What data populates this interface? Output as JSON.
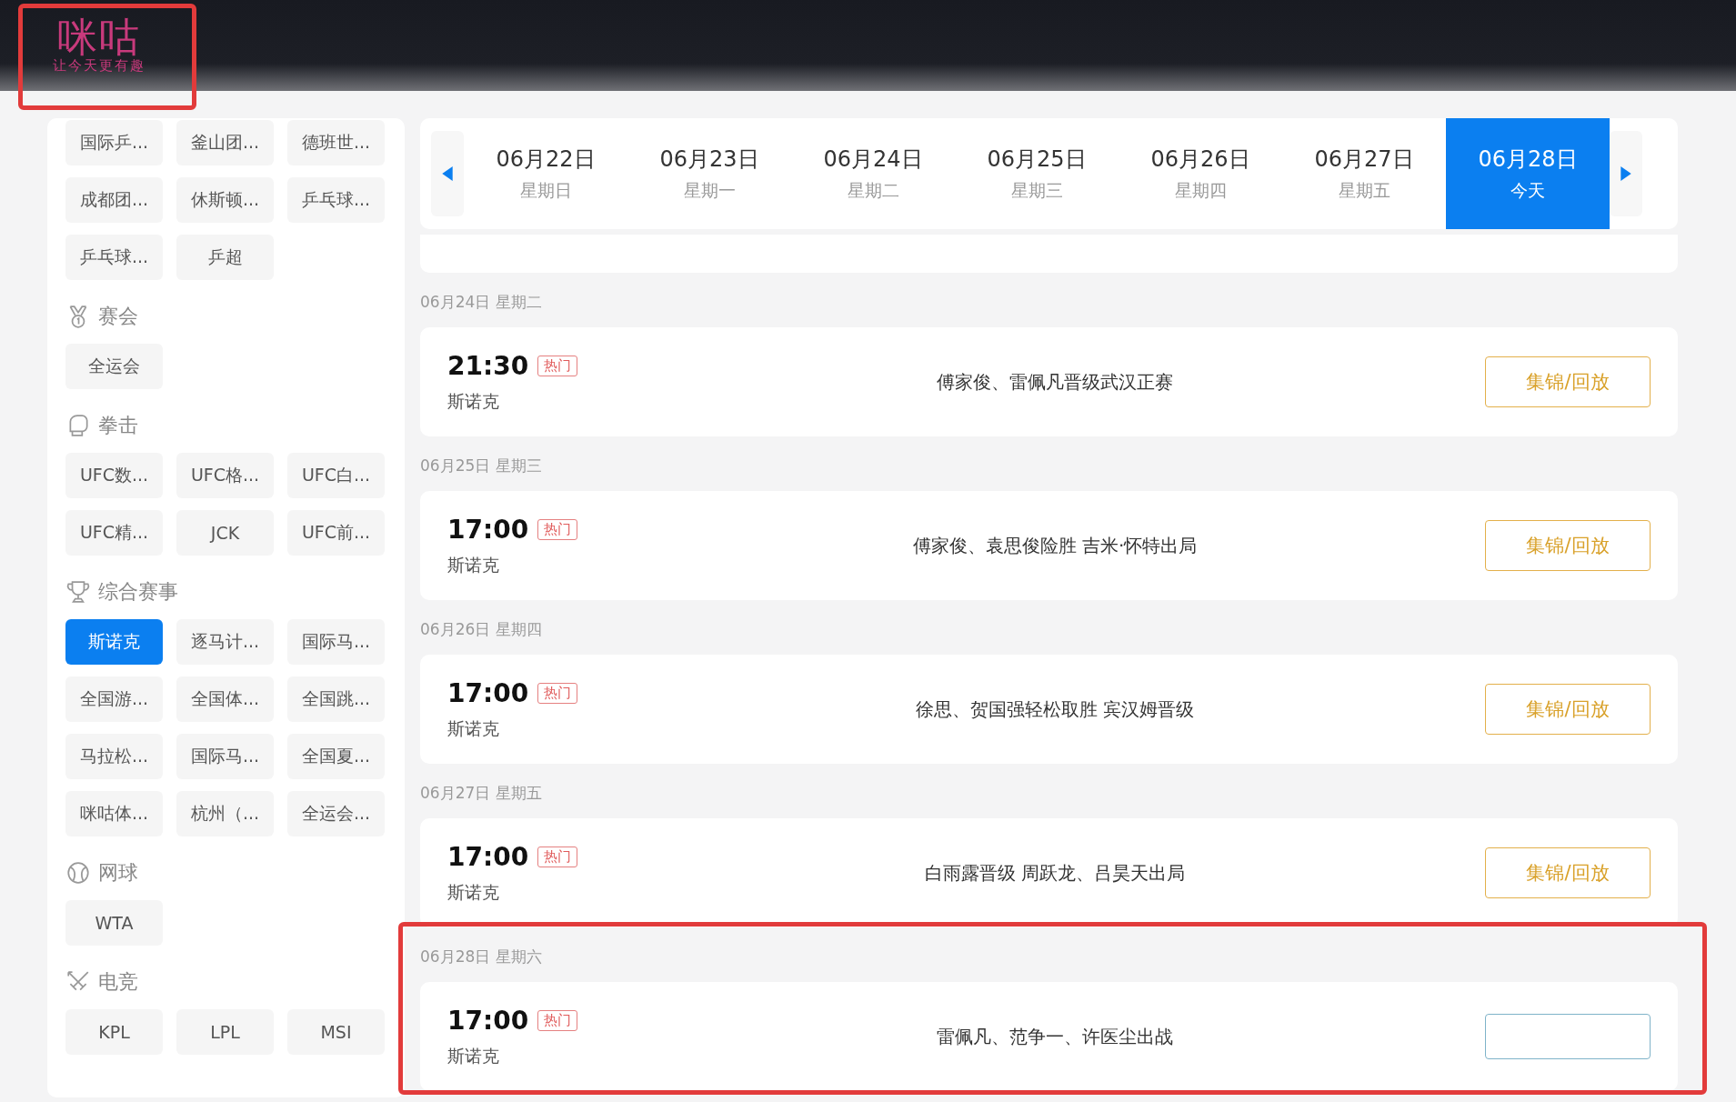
{
  "header": {
    "logo": {
      "name": "咪咕",
      "slogan": "让今天更有趣",
      "highlighted": true
    }
  },
  "sidebar": {
    "groups": [
      {
        "chips": [
          {
            "label": "国际乒...",
            "selected": false
          },
          {
            "label": "釜山团...",
            "selected": false
          },
          {
            "label": "德班世...",
            "selected": false
          },
          {
            "label": "成都团...",
            "selected": false
          },
          {
            "label": "休斯顿...",
            "selected": false
          },
          {
            "label": "乒乓球...",
            "selected": false
          },
          {
            "label": "乒乓球...",
            "selected": false
          },
          {
            "label": "乒超",
            "selected": false
          }
        ]
      },
      {
        "title": "赛会",
        "chips": [
          {
            "label": "全运会",
            "selected": false
          }
        ]
      },
      {
        "title": "拳击",
        "chips": [
          {
            "label": "UFC数...",
            "selected": false
          },
          {
            "label": "UFC格...",
            "selected": false
          },
          {
            "label": "UFC白...",
            "selected": false
          },
          {
            "label": "UFC精...",
            "selected": false
          },
          {
            "label": "JCK",
            "selected": false
          },
          {
            "label": "UFC前...",
            "selected": false
          }
        ]
      },
      {
        "title": "综合赛事",
        "chips": [
          {
            "label": "斯诺克",
            "selected": true
          },
          {
            "label": "逐马计...",
            "selected": false
          },
          {
            "label": "国际马...",
            "selected": false
          },
          {
            "label": "全国游...",
            "selected": false
          },
          {
            "label": "全国体...",
            "selected": false
          },
          {
            "label": "全国跳...",
            "selected": false
          },
          {
            "label": "马拉松...",
            "selected": false
          },
          {
            "label": "国际马...",
            "selected": false
          },
          {
            "label": "全国夏...",
            "selected": false
          },
          {
            "label": "咪咕体...",
            "selected": false
          },
          {
            "label": "杭州（...",
            "selected": false
          },
          {
            "label": "全运会...",
            "selected": false
          }
        ]
      },
      {
        "title": "网球",
        "chips": [
          {
            "label": "WTA",
            "selected": false
          }
        ]
      },
      {
        "title": "电竞",
        "chips": [
          {
            "label": "KPL",
            "selected": false
          },
          {
            "label": "LPL",
            "selected": false
          },
          {
            "label": "MSI",
            "selected": false
          }
        ]
      }
    ]
  },
  "date_tabs": [
    {
      "date": "06月22日",
      "weekday": "星期日",
      "selected": false
    },
    {
      "date": "06月23日",
      "weekday": "星期一",
      "selected": false
    },
    {
      "date": "06月24日",
      "weekday": "星期二",
      "selected": false
    },
    {
      "date": "06月25日",
      "weekday": "星期三",
      "selected": false
    },
    {
      "date": "06月26日",
      "weekday": "星期四",
      "selected": false
    },
    {
      "date": "06月27日",
      "weekday": "星期五",
      "selected": false
    },
    {
      "date": "06月28日",
      "weekday": "今天",
      "selected": true
    }
  ],
  "days": [
    {
      "heading": "06月24日 星期二",
      "highlighted": false,
      "matches": [
        {
          "time": "21:30",
          "hot": true,
          "hot_label": "热门",
          "sport": "斯诺克",
          "title": "傅家俊、雷佩凡晋级武汉正赛",
          "button_label": "集锦/回放"
        }
      ]
    },
    {
      "heading": "06月25日 星期三",
      "highlighted": false,
      "matches": [
        {
          "time": "17:00",
          "hot": true,
          "hot_label": "热门",
          "sport": "斯诺克",
          "title": "傅家俊、袁思俊险胜 吉米·怀特出局",
          "button_label": "集锦/回放"
        }
      ]
    },
    {
      "heading": "06月26日 星期四",
      "highlighted": false,
      "matches": [
        {
          "time": "17:00",
          "hot": true,
          "hot_label": "热门",
          "sport": "斯诺克",
          "title": "徐思、贺国强轻松取胜 宾汉姆晋级",
          "button_label": "集锦/回放"
        }
      ]
    },
    {
      "heading": "06月27日 星期五",
      "highlighted": false,
      "matches": [
        {
          "time": "17:00",
          "hot": true,
          "hot_label": "热门",
          "sport": "斯诺克",
          "title": "白雨露晋级 周跃龙、吕昊天出局",
          "button_label": "集锦/回放"
        }
      ]
    },
    {
      "heading": "06月28日 星期六",
      "highlighted": true,
      "matches": [
        {
          "time": "17:00",
          "hot": true,
          "hot_label": "热门",
          "sport": "斯诺克",
          "title": "雷佩凡、范争一、许医尘出战"
        }
      ]
    }
  ]
}
